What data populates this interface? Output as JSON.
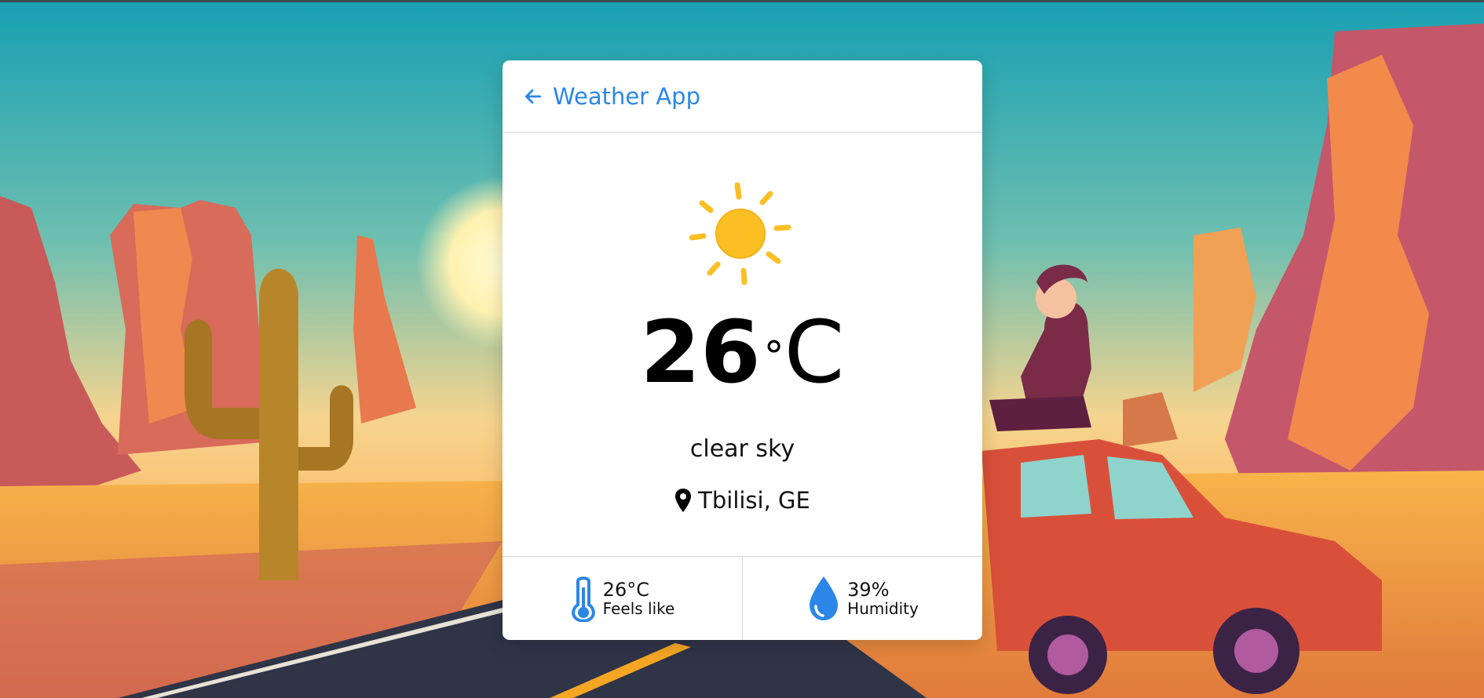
{
  "header": {
    "title": "Weather App",
    "back_icon": "arrow-left-icon"
  },
  "weather": {
    "icon": "sun-icon",
    "temperature": "26",
    "degree_symbol": "°",
    "unit": "C",
    "description": "clear sky",
    "location_icon": "map-pin-icon",
    "location": "Tbilisi, GE"
  },
  "stats": {
    "feels_like": {
      "icon": "thermometer-icon",
      "value": "26°C",
      "label": "Feels like"
    },
    "humidity": {
      "icon": "water-drop-icon",
      "value": "39%",
      "label": "Humidity"
    }
  },
  "colors": {
    "accent": "#2b86e8",
    "sun": "#fbbf24",
    "card_background": "#ffffff"
  }
}
